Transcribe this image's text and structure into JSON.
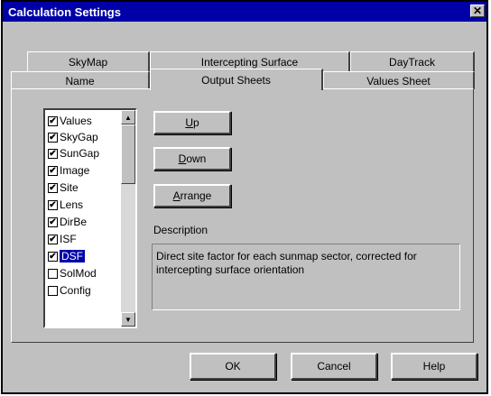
{
  "window": {
    "title": "Calculation Settings",
    "close_glyph": "✕"
  },
  "tabs": {
    "back_row": [
      "SkyMap",
      "Intercepting Surface",
      "DayTrack"
    ],
    "front_row": [
      "Name",
      "Output Sheets",
      "Values Sheet"
    ],
    "active": "Output Sheets"
  },
  "output_list": [
    {
      "label": "Values",
      "checked": true
    },
    {
      "label": "SkyGap",
      "checked": true
    },
    {
      "label": "SunGap",
      "checked": true
    },
    {
      "label": "Image",
      "checked": true
    },
    {
      "label": "Site",
      "checked": true
    },
    {
      "label": "Lens",
      "checked": true
    },
    {
      "label": "DirBe",
      "checked": true
    },
    {
      "label": "ISF",
      "checked": true
    },
    {
      "label": "DSF",
      "checked": true,
      "selected": true
    },
    {
      "label": "SolMod",
      "checked": false
    },
    {
      "label": "Config",
      "checked": false
    }
  ],
  "side_buttons": {
    "up": {
      "mnemonic": "U",
      "rest": "p"
    },
    "down": {
      "mnemonic": "D",
      "rest": "own"
    },
    "arrange": {
      "mnemonic": "A",
      "rest": "rrange"
    }
  },
  "description": {
    "label": "Description",
    "text": "Direct site factor for each sunmap sector, corrected for intercepting surface orientation"
  },
  "bottom_buttons": {
    "ok": "OK",
    "cancel": "Cancel",
    "help": "Help"
  },
  "icons": {
    "checkmark": "✔",
    "scroll_up": "▲",
    "scroll_down": "▼"
  },
  "colors": {
    "face": "#c0c0c0",
    "titlebar": "#0000a8",
    "selection": "#0000a8"
  }
}
